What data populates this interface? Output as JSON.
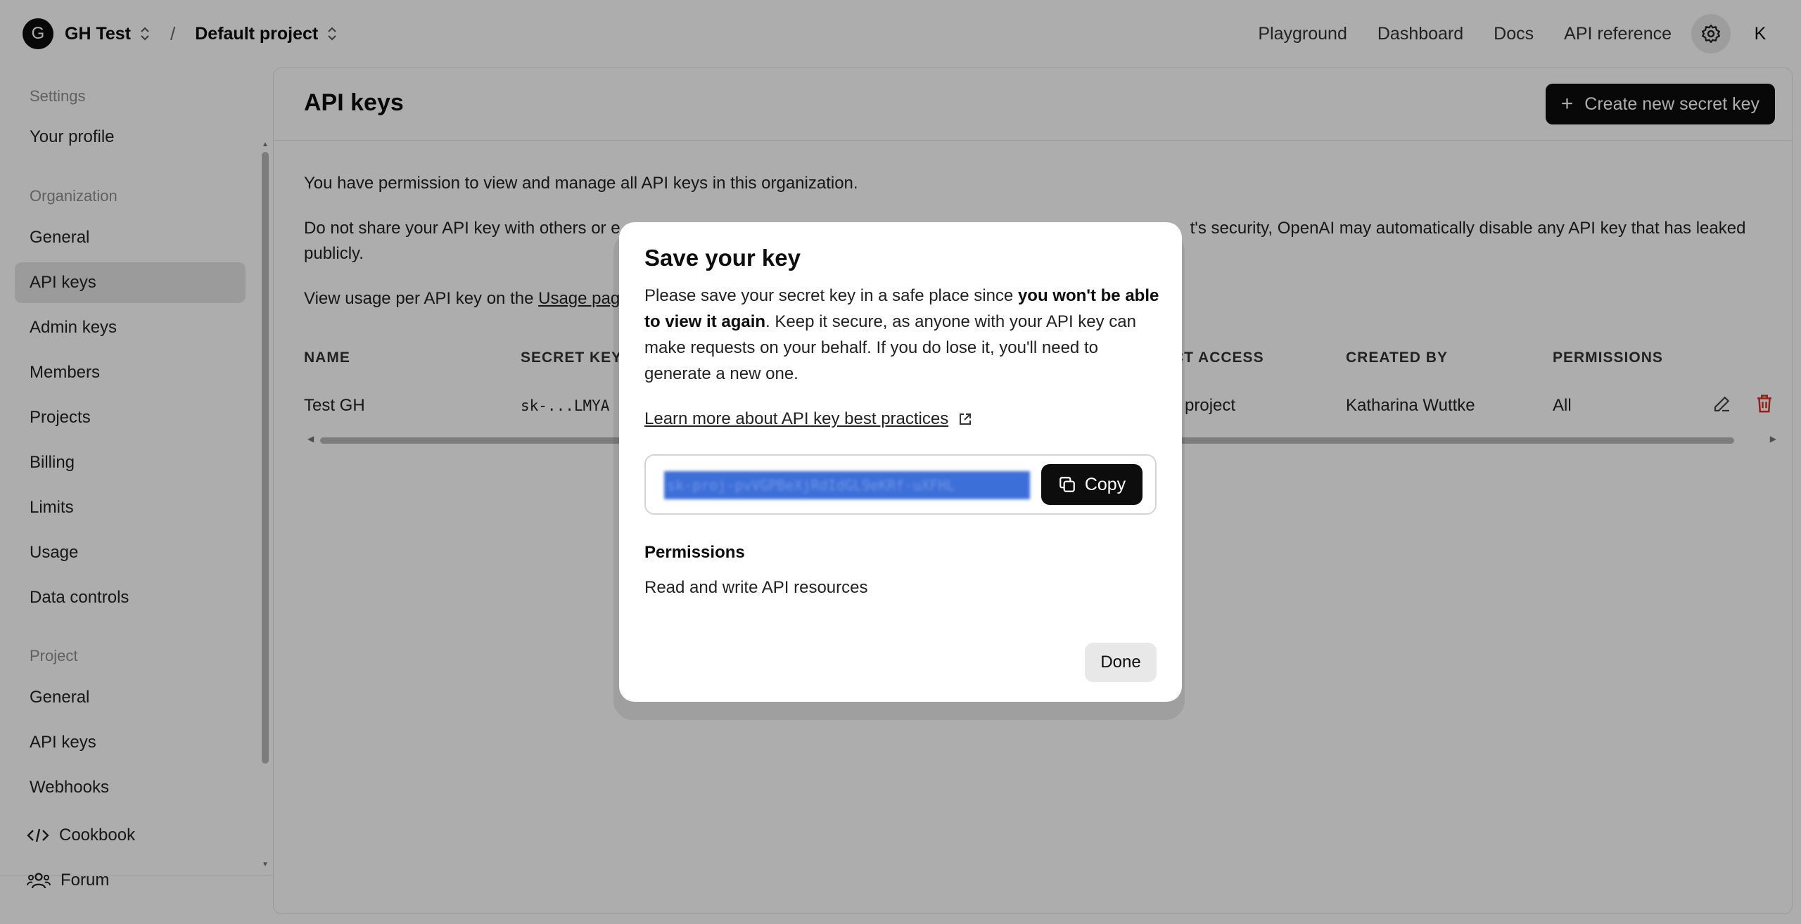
{
  "topbar": {
    "org_initial": "G",
    "org_name": "GH Test",
    "project_name": "Default project",
    "separator": "/",
    "nav": [
      "Playground",
      "Dashboard",
      "Docs",
      "API reference"
    ],
    "user_initial": "K"
  },
  "sidebar": {
    "settings_label": "Settings",
    "your_profile": "Your profile",
    "organization_label": "Organization",
    "org_items": [
      "General",
      "API keys",
      "Admin keys",
      "Members",
      "Projects",
      "Billing",
      "Limits",
      "Usage",
      "Data controls"
    ],
    "active_item": "API keys",
    "project_label": "Project",
    "project_items": [
      "General",
      "API keys",
      "Webhooks"
    ],
    "bottom_items": [
      {
        "label": "Cookbook",
        "icon": "code-icon"
      },
      {
        "label": "Forum",
        "icon": "people-icon"
      }
    ]
  },
  "main": {
    "title": "API keys",
    "create_button": "Create new secret key",
    "permission_text": "You have permission to view and manage all API keys in this organization.",
    "share_warning": "Do not share your API key with others or e",
    "share_warning_tail": "t's security, OpenAI may automatically disable any API key that has leaked",
    "share_warning_line2": "publicly.",
    "usage_text_prefix": "View usage per API key on the ",
    "usage_link": "Usage pag",
    "table": {
      "headers": [
        "NAME",
        "SECRET KEY",
        "ECT ACCESS",
        "CREATED BY",
        "PERMISSIONS"
      ],
      "rows": [
        {
          "name": "Test GH",
          "secret_key": "sk-...LMYA",
          "project_access": "ult project",
          "created_by": "Katharina Wuttke",
          "permissions": "All"
        }
      ]
    }
  },
  "modal": {
    "title": "Save your key",
    "text_before_bold": "Please save your secret key in a safe place since ",
    "text_bold": "you won't be able to view it again",
    "text_after_bold": ". Keep it secure, as anyone with your API key can make requests on your behalf. If you do lose it, you'll need to generate a new one.",
    "learn_link": "Learn more about API key best practices",
    "secret_key_value": "sk-proj-pvVGPBeXjRdIdGL9eKRf-uXFHL",
    "copy_button": "Copy",
    "permissions_label": "Permissions",
    "permissions_value": "Read and write API resources",
    "done_button": "Done"
  },
  "colors": {
    "danger": "#d93025",
    "primary_button": "#0d0d0d",
    "selection": "#3d6fd8"
  }
}
